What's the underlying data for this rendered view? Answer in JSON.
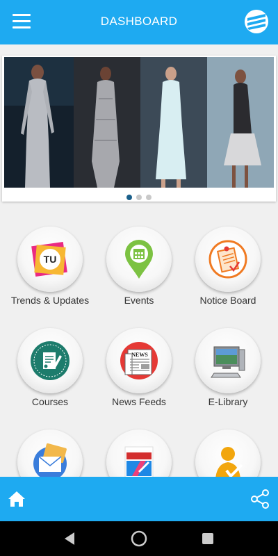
{
  "app_bar": {
    "title": "DASHBOARD"
  },
  "carousel": {
    "slide_count": 3,
    "active_index": 0
  },
  "tiles": [
    {
      "label": "Trends & Updates",
      "icon": "trends-updates-icon"
    },
    {
      "label": "Events",
      "icon": "events-location-icon"
    },
    {
      "label": "Notice Board",
      "icon": "notice-board-icon"
    },
    {
      "label": "Courses",
      "icon": "courses-icon"
    },
    {
      "label": "News Feeds",
      "icon": "newspaper-icon"
    },
    {
      "label": "E-Library",
      "icon": "computer-icon"
    },
    {
      "label": "",
      "icon": "mail-icon"
    },
    {
      "label": "",
      "icon": "iiifd-logo-icon"
    },
    {
      "label": "",
      "icon": "person-check-icon"
    }
  ],
  "bottom_bar": {
    "home_icon": "home-icon",
    "share_icon": "share-icon"
  },
  "colors": {
    "primary": "#1eaaf1",
    "dot_active": "#1a5f8a",
    "dot_inactive": "#c9c9c9"
  }
}
